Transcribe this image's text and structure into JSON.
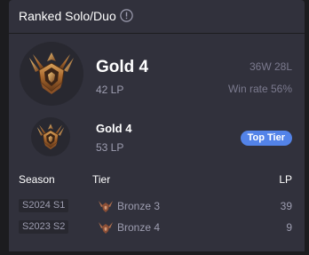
{
  "header": {
    "title": "Ranked Solo/Duo",
    "info_icon": "info-circle-icon"
  },
  "current": {
    "emblem_icon": "gold-rank-emblem-icon",
    "tier": "Gold 4",
    "lp": "42 LP",
    "record": "36W 28L",
    "win_rate": "Win rate 56%"
  },
  "peak": {
    "emblem_icon": "gold-rank-emblem-icon",
    "tier": "Gold 4",
    "lp": "53 LP",
    "badge": "Top Tier",
    "badge_color": "#5383e8"
  },
  "history": {
    "columns": [
      "Season",
      "Tier",
      "LP"
    ],
    "rows": [
      {
        "season": "S2024 S1",
        "tier": "Bronze 3",
        "lp": "39",
        "icon": "bronze-rank-icon"
      },
      {
        "season": "S2023 S2",
        "tier": "Bronze 4",
        "lp": "9",
        "icon": "bronze-rank-icon"
      }
    ]
  },
  "colors": {
    "background": "#1c1c1f",
    "card": "#31313c",
    "accent": "#5383e8",
    "muted_text": "#9e9eb1"
  }
}
